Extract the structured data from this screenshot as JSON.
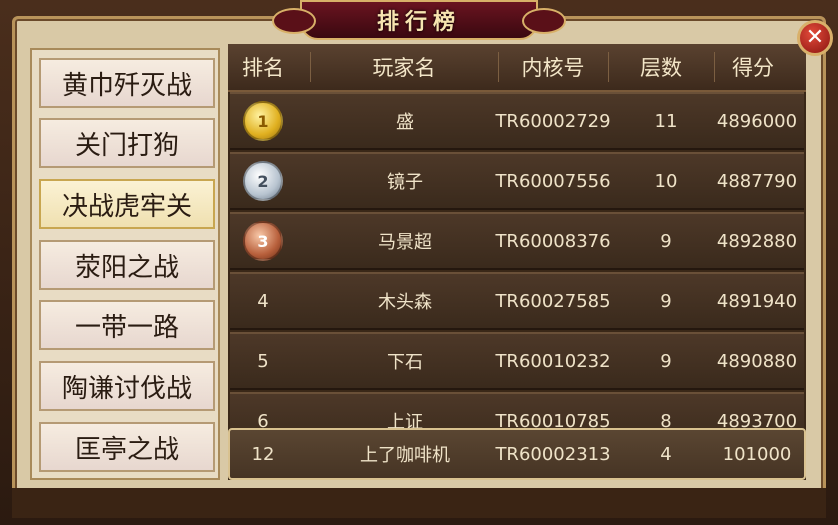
{
  "title": "排行榜",
  "close_symbol": "✕",
  "menu": [
    {
      "label": "黄巾歼灭战",
      "active": false
    },
    {
      "label": "关门打狗",
      "active": false
    },
    {
      "label": "决战虎牢关",
      "active": true
    },
    {
      "label": "荥阳之战",
      "active": false
    },
    {
      "label": "一带一路",
      "active": false
    },
    {
      "label": "陶谦讨伐战",
      "active": false
    },
    {
      "label": "匡亭之战",
      "active": false
    }
  ],
  "table": {
    "headers": [
      "排名",
      "玩家名",
      "内核号",
      "层数",
      "得分"
    ],
    "rows": [
      {
        "rank": "1",
        "medal": "gold",
        "name": "盛",
        "id": "TR60002729",
        "floors": "11",
        "score": "4896000"
      },
      {
        "rank": "2",
        "medal": "silver",
        "name": "镜子",
        "id": "TR60007556",
        "floors": "10",
        "score": "4887790"
      },
      {
        "rank": "3",
        "medal": "bronze",
        "name": "马景超",
        "id": "TR60008376",
        "floors": "9",
        "score": "4892880"
      },
      {
        "rank": "4",
        "medal": "",
        "name": "木头森",
        "id": "TR60027585",
        "floors": "9",
        "score": "4891940"
      },
      {
        "rank": "5",
        "medal": "",
        "name": "下石",
        "id": "TR60010232",
        "floors": "9",
        "score": "4890880"
      },
      {
        "rank": "6",
        "medal": "",
        "name": "上证",
        "id": "TR60010785",
        "floors": "8",
        "score": "4893700"
      }
    ],
    "my_row": {
      "rank": "12",
      "name": "上了咖啡机",
      "id": "TR60002313",
      "floors": "4",
      "score": "101000"
    }
  },
  "colors": {
    "accent_gold": "#d8b068",
    "title_bg": "#6a1420",
    "close_bg": "#c02a1e"
  },
  "icons": [
    "close-icon",
    "gold-medal-icon",
    "silver-medal-icon",
    "bronze-medal-icon"
  ]
}
